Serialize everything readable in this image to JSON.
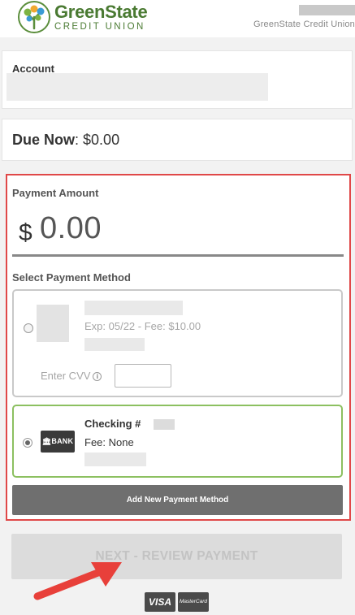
{
  "header": {
    "brand_name": "GreenState",
    "brand_sub": "CREDIT UNION",
    "org_label": "GreenState Credit Union"
  },
  "account": {
    "label": "Account"
  },
  "due": {
    "label": "Due Now",
    "sep": ": ",
    "amount": "$0.00"
  },
  "payment": {
    "amount_label": "Payment Amount",
    "currency": "$",
    "amount": "0.00",
    "method_label": "Select Payment Method"
  },
  "methods": {
    "card": {
      "exp_fee": "Exp: 05/22 - Fee: $10.00",
      "cvv_label": "Enter CVV",
      "info_glyph": "i"
    },
    "checking": {
      "logo_text": "🏛BANK",
      "title": "Checking #",
      "fee": "Fee: None",
      "selected": true
    }
  },
  "buttons": {
    "add_method": "Add New Payment Method",
    "next": "NEXT - REVIEW PAYMENT"
  },
  "cards_accepted": {
    "visa": "VISA",
    "mastercard": "MasterCard"
  },
  "colors": {
    "brand_green": "#4a7a32",
    "highlight_red": "#e04848",
    "selected_green": "#8cc060",
    "arrow_red": "#e8403a"
  }
}
